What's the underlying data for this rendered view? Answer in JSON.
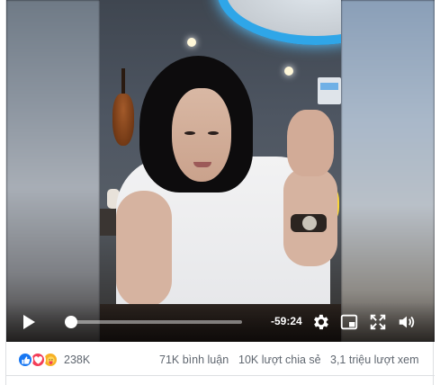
{
  "video": {
    "time_remaining": "-59:24",
    "progress_fraction": 0.03
  },
  "controls": {
    "play_icon": "play-icon",
    "settings_icon": "gear-icon",
    "pip_icon": "picture-in-picture-icon",
    "fullscreen_icon": "fullscreen-icon",
    "volume_icon": "volume-icon"
  },
  "stats": {
    "reactions": [
      "like",
      "love",
      "care"
    ],
    "reaction_count": "238K",
    "comments": "71K bình luận",
    "shares": "10K lượt chia sẻ",
    "views": "3,1 triệu lượt xem"
  },
  "colors": {
    "like": "#1877f2",
    "love": "#f33e58",
    "care": "#f7b125",
    "ceiling_light": "#2fa6e8"
  }
}
